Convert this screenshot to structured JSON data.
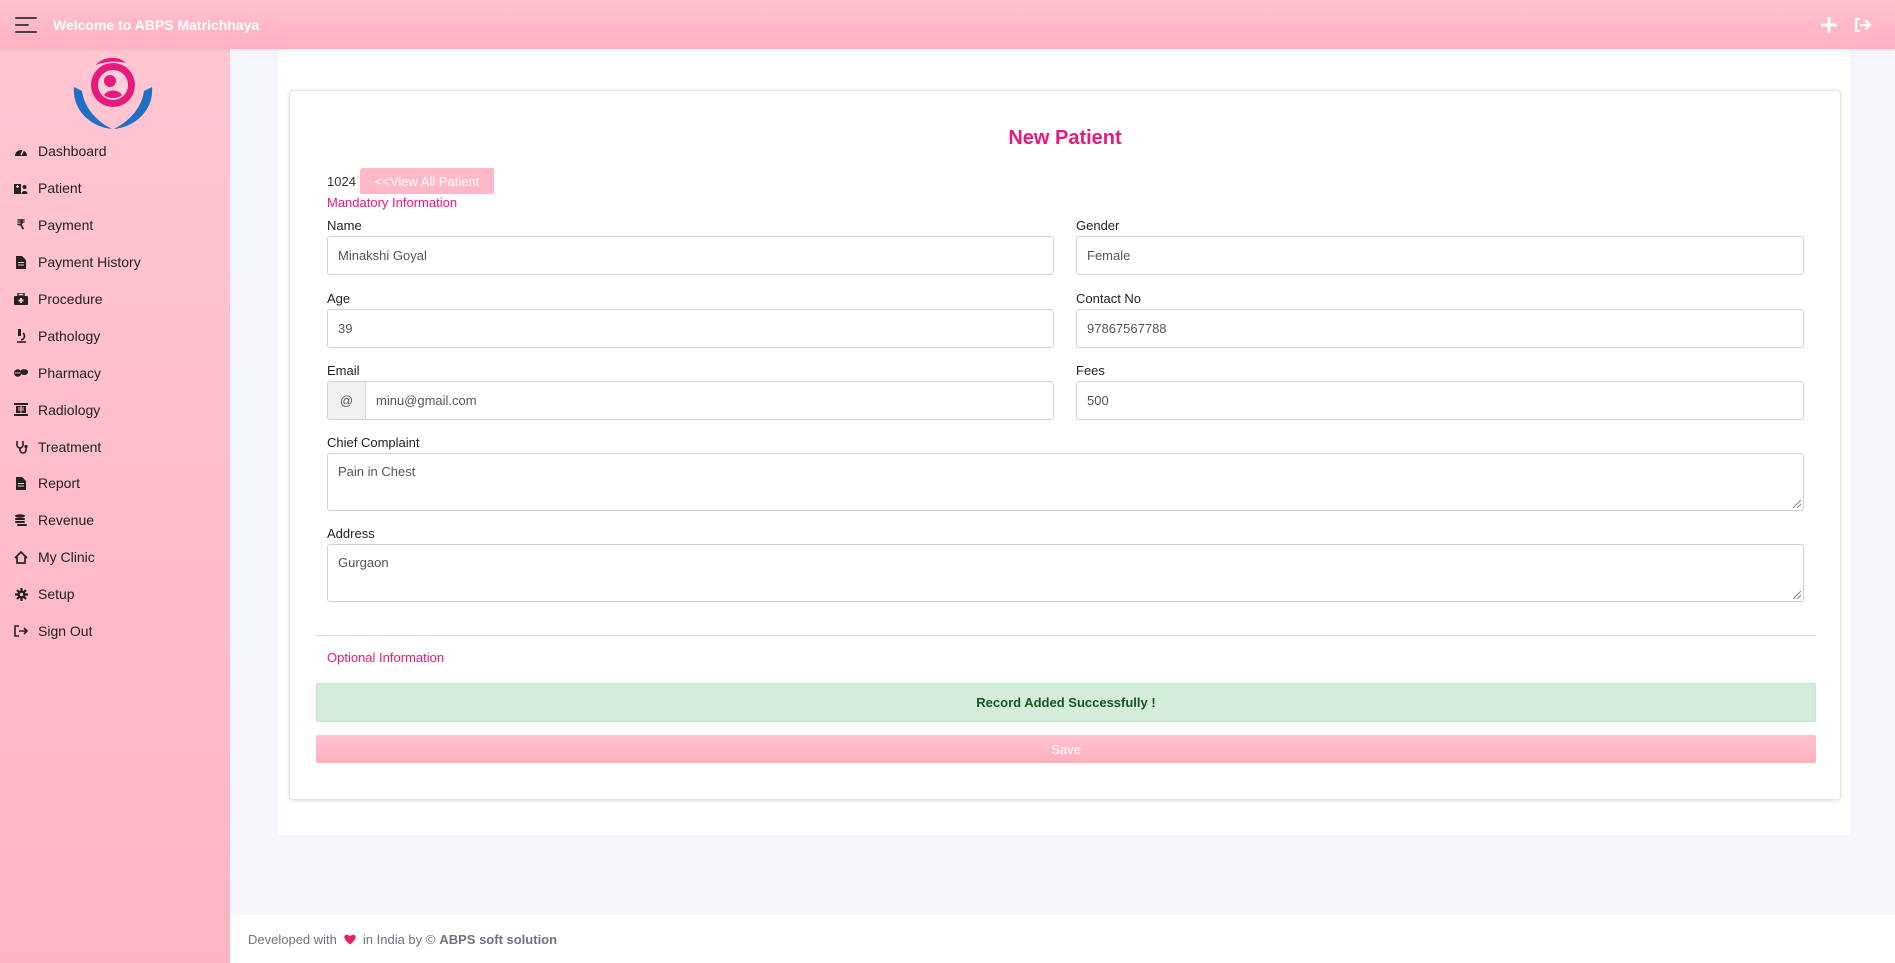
{
  "app": {
    "title": "Welcome to ABPS Matrichhaya"
  },
  "topbar": {
    "menu_icon": "hamburger-icon",
    "add_icon": "plus-icon",
    "signout_icon": "sign-out-icon"
  },
  "sidebar": {
    "logo_icon": "mother-child-hands-logo",
    "items": [
      {
        "label": "Dashboard",
        "icon": "tachometer-icon"
      },
      {
        "label": "Patient",
        "icon": "hospital-user-icon"
      },
      {
        "label": "Payment",
        "icon": "rupee-icon"
      },
      {
        "label": "Payment History",
        "icon": "file-invoice-icon"
      },
      {
        "label": "Procedure",
        "icon": "medkit-icon"
      },
      {
        "label": "Pathology",
        "icon": "microscope-icon"
      },
      {
        "label": "Pharmacy",
        "icon": "pills-icon"
      },
      {
        "label": "Radiology",
        "icon": "x-ray-icon"
      },
      {
        "label": "Treatment",
        "icon": "stethoscope-icon"
      },
      {
        "label": "Report",
        "icon": "file-icon"
      },
      {
        "label": "Revenue",
        "icon": "coins-icon"
      },
      {
        "label": "My Clinic",
        "icon": "clinic-home-icon"
      },
      {
        "label": "Setup",
        "icon": "gear-icon"
      },
      {
        "label": "Sign Out",
        "icon": "sign-out-icon"
      }
    ]
  },
  "form": {
    "title": "New Patient",
    "patient_id": "1024",
    "view_all_label": "<<View All Patient",
    "mandatory_title": "Mandatory Information",
    "optional_title": "Optional Information",
    "fields": {
      "name": {
        "label": "Name",
        "value": "Minakshi Goyal"
      },
      "gender": {
        "label": "Gender",
        "value": "Female"
      },
      "age": {
        "label": "Age",
        "value": "39"
      },
      "contact": {
        "label": "Contact No",
        "value": "97867567788"
      },
      "email": {
        "label": "Email",
        "prefix": "@",
        "value": "minu@gmail.com"
      },
      "fees": {
        "label": "Fees",
        "value": "500"
      },
      "chief_complaint": {
        "label": "Chief Complaint",
        "value": "Pain in Chest"
      },
      "address": {
        "label": "Address",
        "value": "Gurgaon"
      }
    },
    "alert": "Record Added Successfully !",
    "save_label": "Save"
  },
  "footer": {
    "prefix": "Developed with",
    "middle": "in India by ©",
    "brand": "ABPS soft solution",
    "heart_icon": "heart-icon"
  },
  "colors": {
    "accent": "#e8197c",
    "topbar": "#ffb6c6",
    "sidebar": "#ffbccb",
    "success_bg": "#d4edda",
    "success_text": "#155724"
  }
}
